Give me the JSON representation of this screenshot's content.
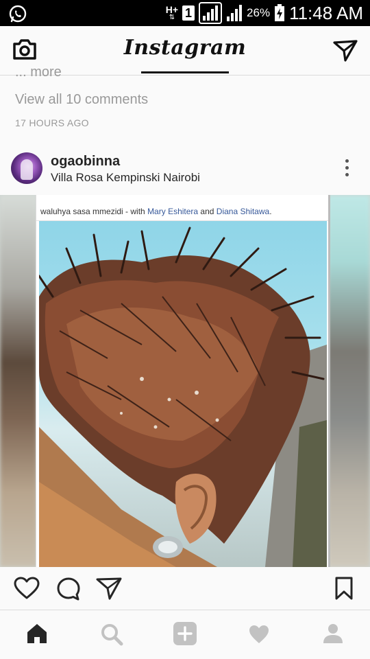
{
  "status_bar": {
    "network_type": "H+",
    "sim_slot": "1",
    "battery_percent": "26%",
    "time": "11:48 AM"
  },
  "header": {
    "title": "Instagram",
    "camera_icon": "camera-icon",
    "direct_icon": "paper-plane-icon"
  },
  "previous_post": {
    "more_text": "... more",
    "view_comments": "View all 10 comments",
    "time_ago": "17 HOURS AGO"
  },
  "post": {
    "username": "ogaobinna",
    "location": "Villa Rosa Kempinski Nairobi",
    "caption_prefix": "waluhya sasa mmezidi - with ",
    "tag1": "Mary Eshitera",
    "caption_and": " and ",
    "tag2": "Diana Shitawa",
    "caption_suffix": "."
  },
  "actions": {
    "like_icon": "heart-outline-icon",
    "comment_icon": "comment-bubble-icon",
    "share_icon": "paper-plane-icon",
    "save_icon": "bookmark-icon"
  },
  "bottom_nav": {
    "items": [
      "home-icon",
      "search-icon",
      "add-icon",
      "activity-heart-icon",
      "profile-icon"
    ],
    "active": "home-icon"
  },
  "colors": {
    "status_bar_bg": "#000000",
    "app_bg": "#fafafa",
    "secondary_text": "#999999",
    "tag_link": "#365899"
  }
}
